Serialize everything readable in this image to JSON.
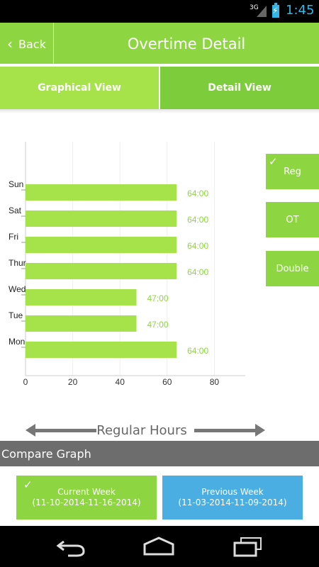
{
  "status_bar": {
    "network": "3G",
    "time": "1:45"
  },
  "header": {
    "back_label": "Back",
    "title": "Overtime Detail"
  },
  "tabs": [
    {
      "label": "Graphical View"
    },
    {
      "label": "Detail View"
    }
  ],
  "side_buttons": [
    {
      "label": "Reg",
      "checked": true
    },
    {
      "label": "OT"
    },
    {
      "label": "Double"
    }
  ],
  "chart_data": {
    "type": "bar",
    "orientation": "horizontal",
    "categories": [
      "Sun",
      "Sat",
      "Fri",
      "Thur",
      "Wed",
      "Tue",
      "Mon"
    ],
    "values": [
      64,
      64,
      64,
      64,
      47,
      47,
      64
    ],
    "value_labels": [
      "64:00",
      "64:00",
      "64:00",
      "64:00",
      "47:00",
      "47:00",
      "64:00"
    ],
    "x_ticks": [
      0,
      20,
      40,
      60,
      80
    ],
    "xlim": [
      0,
      93
    ],
    "xlabel": "Regular Hours",
    "grid": true,
    "bar_color": "#a6e34a",
    "label_color": "#8ed641"
  },
  "compare": {
    "title": "Compare Graph",
    "current": {
      "label": "Current Week",
      "range": "(11-10-2014-11-16-2014)"
    },
    "previous": {
      "label": "Previous Week",
      "range": "(11-03-2014-11-09-2014)"
    }
  },
  "nav": {
    "icons": [
      "back-icon",
      "home-icon",
      "recent-apps-icon"
    ]
  }
}
